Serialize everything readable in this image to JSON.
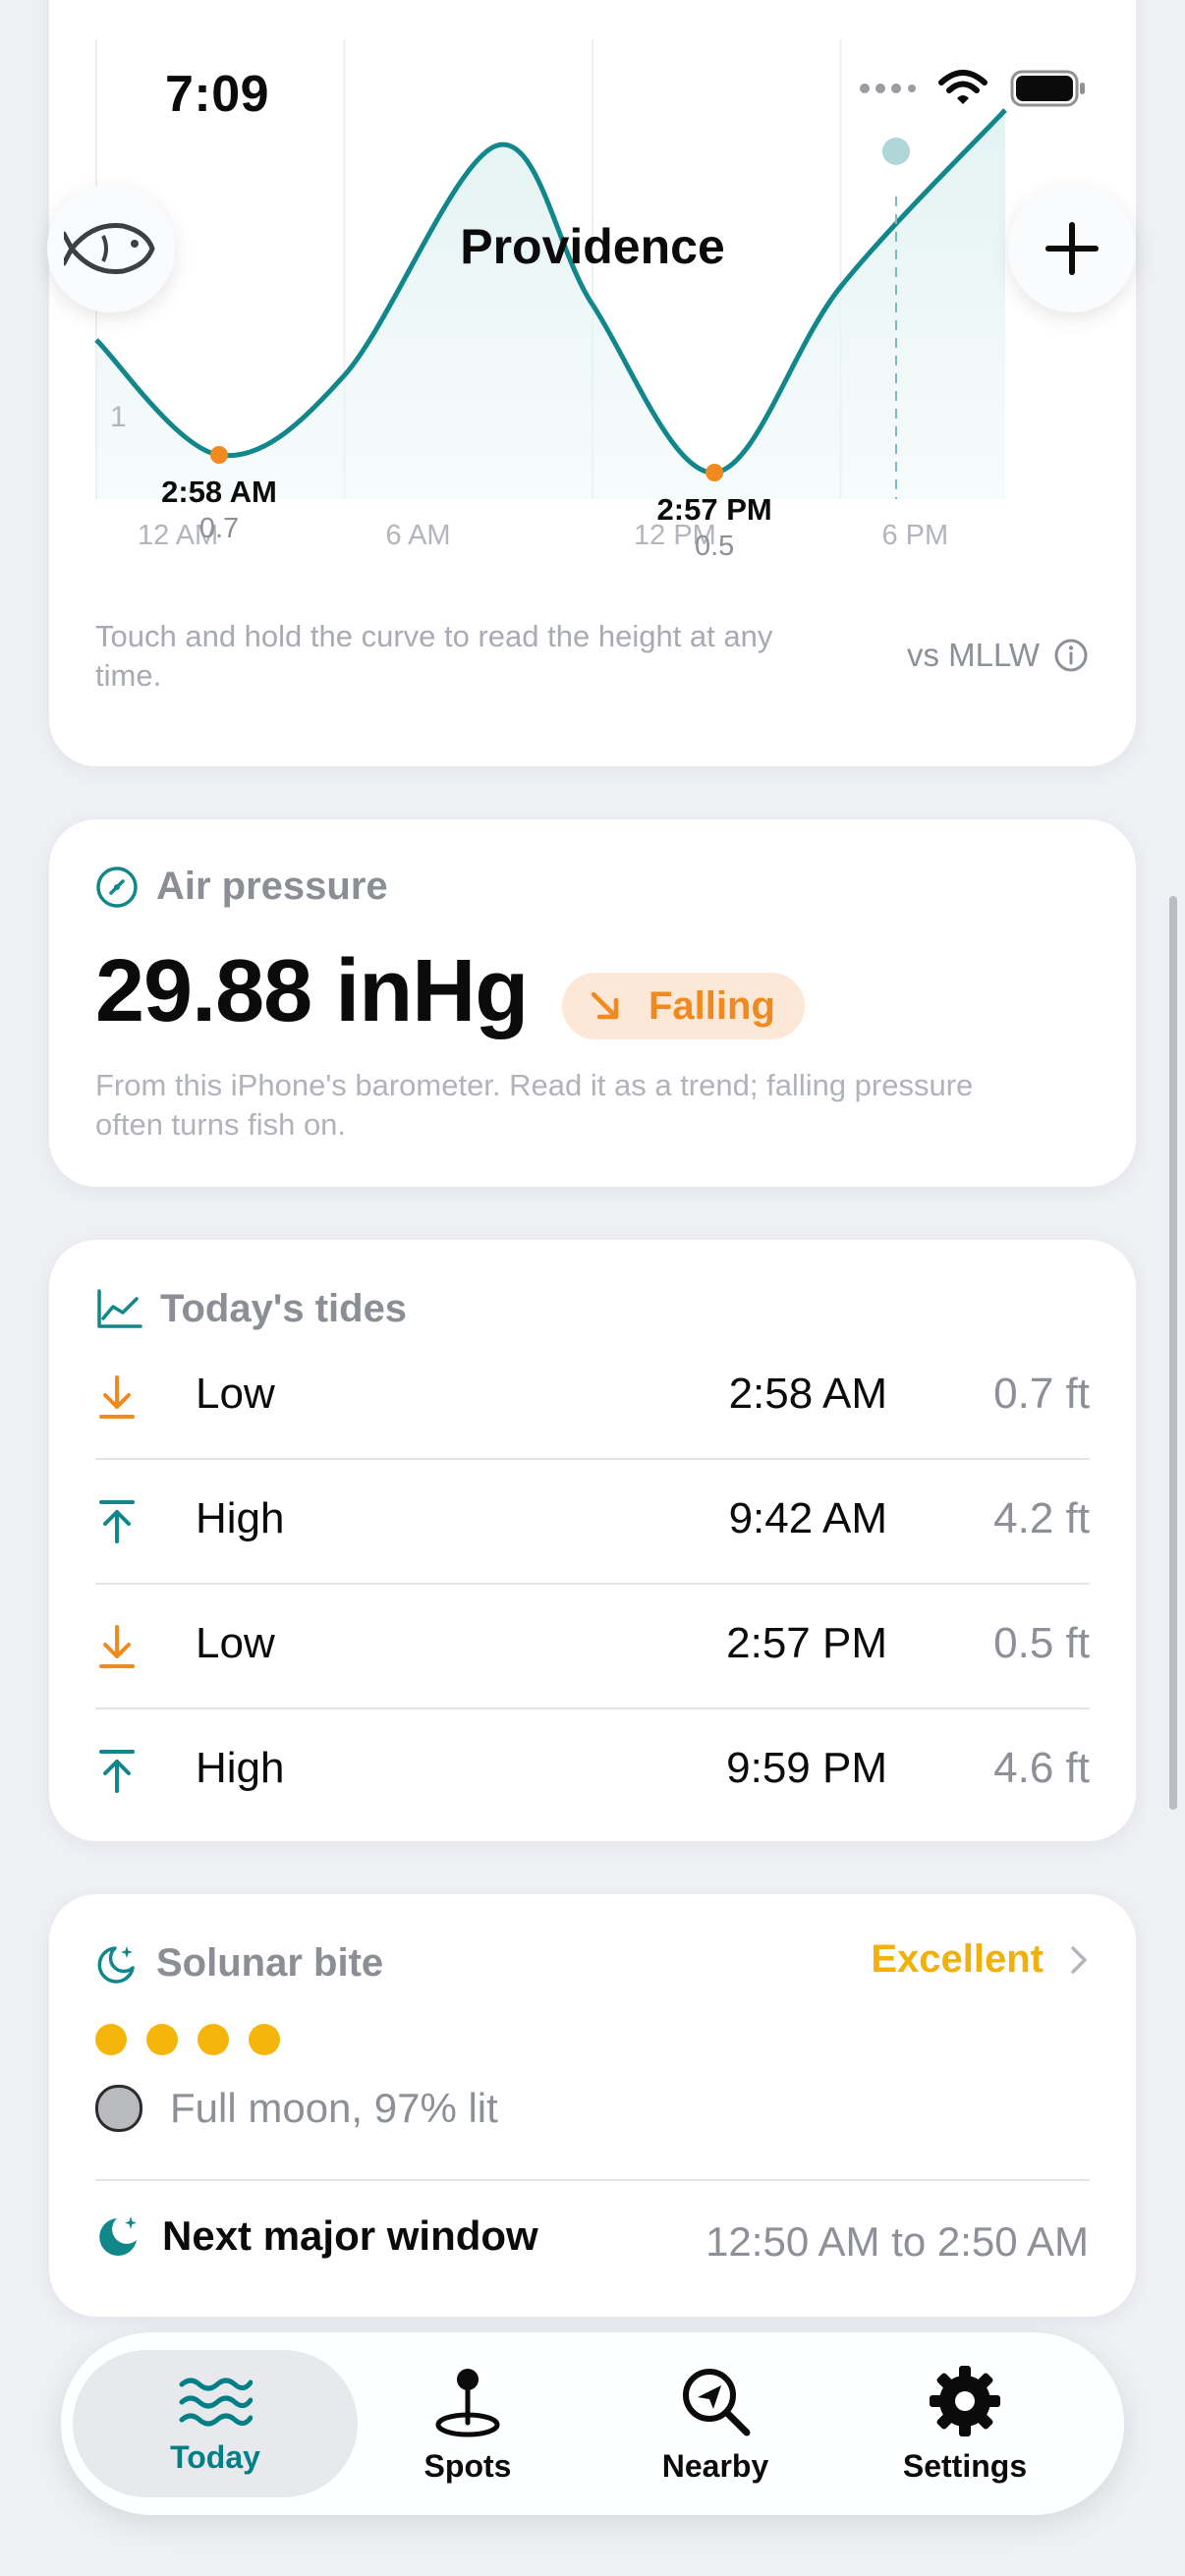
{
  "status_bar": {
    "time": "7:09"
  },
  "header": {
    "title": "Providence",
    "left_icon": "fish-icon",
    "right_icon": "plus-icon"
  },
  "tide_chart": {
    "y_tick": "1",
    "x_ticks": [
      "12 AM",
      "6 AM",
      "12 PM",
      "6 PM"
    ],
    "annotations": [
      {
        "time": "2:58 AM",
        "height": "0.7"
      },
      {
        "time": "2:57 PM",
        "height": "0.5"
      }
    ],
    "note": "Touch and hold the curve to read the height at any time.",
    "datum": "vs MLLW",
    "colors": {
      "curve": "#11878c",
      "marker": "#f08a1f"
    }
  },
  "chart_data": {
    "type": "line",
    "x": [
      "12 AM",
      "2:58 AM",
      "6 AM",
      "9:42 AM",
      "12 PM",
      "2:57 PM",
      "6 PM",
      "9:59 PM"
    ],
    "series": [
      {
        "values": [
          2.0,
          0.7,
          1.6,
          4.2,
          2.4,
          0.5,
          2.6,
          4.6
        ]
      }
    ],
    "ylim": [
      0,
      5
    ],
    "grid": true
  },
  "air_pressure": {
    "title": "Air pressure",
    "value": "29.88 inHg",
    "trend": "Falling",
    "note": "From this iPhone's barometer. Read it as a trend; falling pressure often turns fish on.",
    "colors": {
      "trend": "#f08a1f",
      "trend_bg": "#fde8d7"
    }
  },
  "todays_tides": {
    "title": "Today's tides",
    "rows": [
      {
        "type": "Low",
        "time": "2:58 AM",
        "height": "0.7 ft",
        "icon": "arrow-down-to-line-icon"
      },
      {
        "type": "High",
        "time": "9:42 AM",
        "height": "4.2 ft",
        "icon": "arrow-up-from-line-icon"
      },
      {
        "type": "Low",
        "time": "2:57 PM",
        "height": "0.5 ft",
        "icon": "arrow-down-to-line-icon"
      },
      {
        "type": "High",
        "time": "9:59 PM",
        "height": "4.6 ft",
        "icon": "arrow-up-from-line-icon"
      }
    ]
  },
  "solunar": {
    "title": "Solunar bite",
    "rating": "Excellent",
    "rating_dots": 4,
    "moon_phase": "Full moon, 97% lit",
    "next_major_label": "Next major window",
    "next_major_time": "12:50 AM to 2:50 AM",
    "colors": {
      "rating": "#f2b00c"
    }
  },
  "tab_bar": {
    "tabs": [
      {
        "label": "Today",
        "icon": "waves-icon",
        "active": true
      },
      {
        "label": "Spots",
        "icon": "pin-icon",
        "active": false
      },
      {
        "label": "Nearby",
        "icon": "location-search-icon",
        "active": false
      },
      {
        "label": "Settings",
        "icon": "gear-icon",
        "active": false
      }
    ],
    "colors": {
      "active": "#007f86"
    }
  }
}
